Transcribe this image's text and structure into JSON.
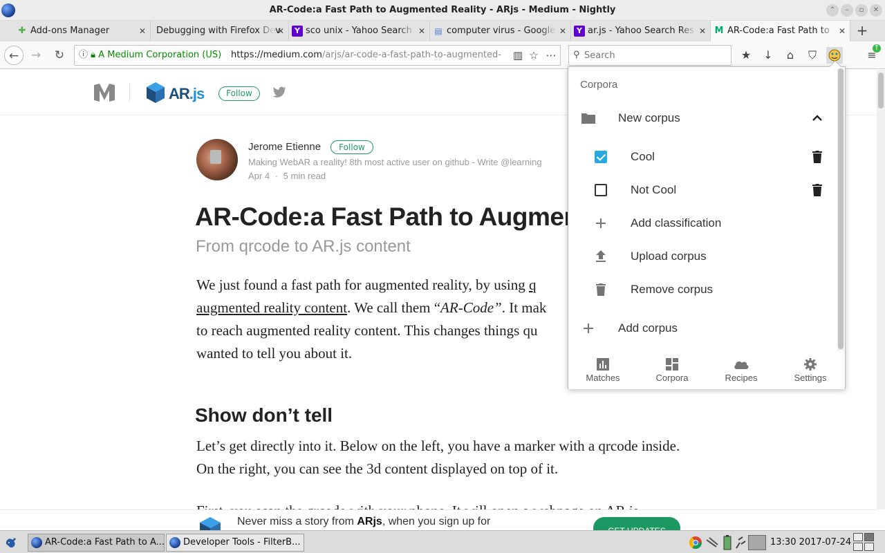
{
  "window": {
    "title": "AR-Code:a Fast Path to Augmented Reality - ARjs - Medium - Nightly",
    "controls": [
      "up-icon",
      "minimize-icon",
      "maximize-icon",
      "close-icon"
    ]
  },
  "tabs": [
    {
      "label": "Add-ons Manager",
      "icon": "puzzle-icon",
      "active": false
    },
    {
      "label": "Debugging with Firefox Dev",
      "icon": "",
      "active": false
    },
    {
      "label": "sco unix - Yahoo Search",
      "icon": "yahoo-icon",
      "active": false
    },
    {
      "label": "computer virus - Google",
      "icon": "google-docs-icon",
      "active": false
    },
    {
      "label": "ar.js - Yahoo Search Res",
      "icon": "yahoo-icon",
      "active": false
    },
    {
      "label": "AR-Code:a Fast Path to",
      "icon": "medium-icon",
      "active": true
    }
  ],
  "navbar": {
    "identity": "A Medium Corporation (US)",
    "url_domain": "https://medium.com",
    "url_path": "/arjs/ar-code-a-fast-path-to-augmented-",
    "search_placeholder": "Search"
  },
  "page": {
    "publication_follow": "Follow",
    "author": {
      "name": "Jerome Etienne",
      "follow": "Follow",
      "bio": "Making WebAR a reality! 8th most active user on github - Write @learning",
      "date": "Apr 4",
      "read_time": "5 min read",
      "separator": "·"
    },
    "title": "AR-Code:a Fast Path to Augmente",
    "subtitle": "From qrcode to AR.js content",
    "para1": {
      "a": "We just found a fast path for augmented reality, by using ",
      "link1": "q",
      "link2": "augmented reality content",
      "b": ". We call them “",
      "em": "AR-Code”",
      "c": ". It mak",
      "line3": "to reach augmented reality content. This changes things qu",
      "line4": "wanted to tell you about it."
    },
    "section_heading": "Show don’t tell",
    "para2": "Let’s get directly into it. Below on the left, you have a marker with a qrcode inside. On the right, you can see the 3d content displayed on top of it.",
    "para3": "First, you scan the qrcode with your phone. It will open a webpage on AR.js"
  },
  "banner": {
    "text_before": "Never miss a story from ",
    "publication": "ARjs",
    "text_after": ", when you sign up for",
    "cta": "GET UPDATES"
  },
  "popup": {
    "heading": "Corpora",
    "corpus_name": "New corpus",
    "classifications": [
      {
        "label": "Cool",
        "checked": true
      },
      {
        "label": "Not Cool",
        "checked": false
      }
    ],
    "add_classification": "Add classification",
    "upload_corpus": "Upload corpus",
    "remove_corpus": "Remove corpus",
    "add_corpus": "Add corpus",
    "nav": [
      {
        "label": "Matches",
        "icon": "bar-chart-icon"
      },
      {
        "label": "Corpora",
        "icon": "dashboard-icon"
      },
      {
        "label": "Recipes",
        "icon": "cloud-icon"
      },
      {
        "label": "Settings",
        "icon": "gear-icon"
      }
    ]
  },
  "taskbar": {
    "tasks": [
      {
        "label": "AR-Code:a Fast Path to A...",
        "active": true
      },
      {
        "label": "Developer Tools - FilterB...",
        "active": false
      }
    ],
    "clock": "13:30 2017-07-24"
  },
  "colors": {
    "medium_green": "#1c9963",
    "checkbox_blue": "#2aa8e0",
    "identity_green": "#058b00"
  }
}
